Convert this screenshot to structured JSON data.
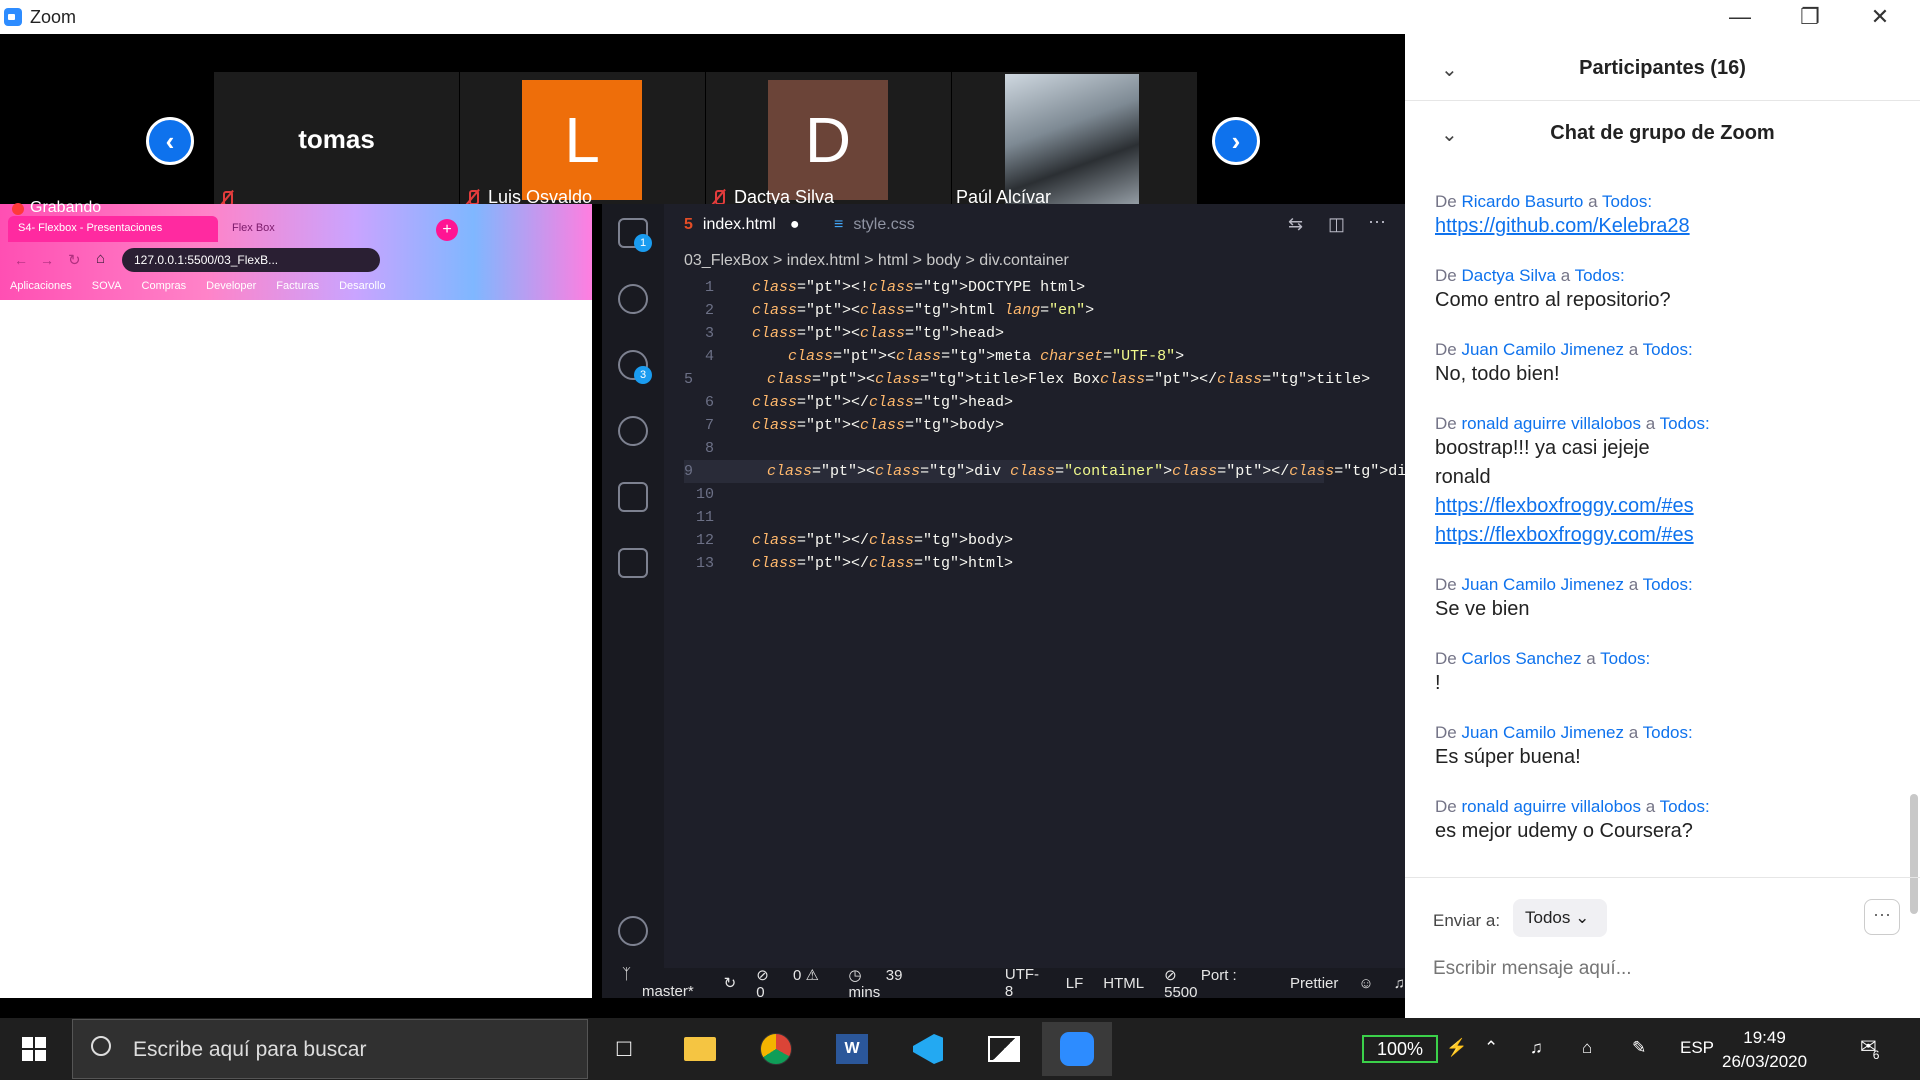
{
  "window": {
    "title": "Zoom"
  },
  "participants_strip": {
    "tiles": [
      {
        "name": "tomas",
        "label": "tomas"
      },
      {
        "name": "Luis Osvaldo",
        "letter": "L",
        "color": "#ee6e0a"
      },
      {
        "name": "Dactya Silva",
        "letter": "D",
        "color": "#6b4438"
      },
      {
        "name": "Paúl Alcívar"
      }
    ]
  },
  "recording": {
    "label": "Grabando"
  },
  "browser": {
    "tabs": [
      "S4- Flexbox - Presentaciones",
      "Flex Box"
    ],
    "url": "127.0.0.1:5500/03_FlexB...",
    "bookmarks": [
      "Aplicaciones",
      "SOVA",
      "Compras",
      "Developer",
      "Facturas",
      "Desarollo"
    ]
  },
  "vscode": {
    "tabs": [
      {
        "label": "index.html",
        "active": true,
        "modified": true
      },
      {
        "label": "style.css",
        "active": false
      }
    ],
    "breadcrumb": [
      "03_FlexBox",
      "index.html",
      "html",
      "body",
      "div.container"
    ],
    "badges": {
      "explorer": "1",
      "scm": "3"
    },
    "code": [
      {
        "n": "1",
        "t": "<!DOCTYPE html>"
      },
      {
        "n": "2",
        "t": "<html lang=\"en\">"
      },
      {
        "n": "3",
        "t": "<head>"
      },
      {
        "n": "4",
        "t": "    <meta charset=\"UTF-8\">"
      },
      {
        "n": "5",
        "t": "    <title>Flex Box</title>"
      },
      {
        "n": "6",
        "t": "</head>"
      },
      {
        "n": "7",
        "t": "<body>"
      },
      {
        "n": "8",
        "t": ""
      },
      {
        "n": "9",
        "t": "    <div class=\"container\"></div>"
      },
      {
        "n": "10",
        "t": ""
      },
      {
        "n": "11",
        "t": ""
      },
      {
        "n": "12",
        "t": "</body>"
      },
      {
        "n": "13",
        "t": "</html>"
      }
    ],
    "status": {
      "branch": "master*",
      "problems": "0 ⚠ 0",
      "time": "39 mins",
      "encoding": "UTF-8",
      "eol": "LF",
      "language": "HTML",
      "port": "Port : 5500",
      "formatter": "Prettier"
    }
  },
  "chat_panel": {
    "participants_header": "Participantes (16)",
    "chat_header": "Chat de grupo de Zoom",
    "from_word": "De",
    "to_word": "a",
    "messages": [
      {
        "from": "Ricardo Basurto",
        "to": "Todos:",
        "lines": [],
        "links": [
          "https://github.com/Kelebra28"
        ]
      },
      {
        "from": "Dactya Silva",
        "to": "Todos:",
        "lines": [
          "Como entro al repositorio?"
        ],
        "links": []
      },
      {
        "from": "Juan Camilo Jimenez",
        "to": "Todos:",
        "lines": [
          "No, todo bien!"
        ],
        "links": []
      },
      {
        "from": "ronald aguirre villalobos",
        "to": "Todos:",
        "lines": [
          "boostrap!!! ya casi jejeje",
          "ronald"
        ],
        "links": [
          "https://flexboxfroggy.com/#es",
          "https://flexboxfroggy.com/#es"
        ]
      },
      {
        "from": "Juan Camilo Jimenez",
        "to": "Todos:",
        "lines": [
          "Se ve bien"
        ],
        "links": []
      },
      {
        "from": "Carlos Sanchez",
        "to": "Todos:",
        "lines": [
          "!"
        ],
        "links": []
      },
      {
        "from": "Juan Camilo Jimenez",
        "to": "Todos:",
        "lines": [
          "Es súper buena!"
        ],
        "links": []
      },
      {
        "from": "ronald aguirre villalobos",
        "to": "Todos:",
        "lines": [
          "es mejor udemy o Coursera?"
        ],
        "links": []
      }
    ],
    "send_to_label": "Enviar a:",
    "send_to_value": "Todos",
    "input_placeholder": "Escribir mensaje aquí..."
  },
  "taskbar": {
    "search_placeholder": "Escribe aquí para buscar",
    "battery": "100%",
    "language": "ESP",
    "time": "19:49",
    "date": "26/03/2020",
    "notifications": "6"
  }
}
